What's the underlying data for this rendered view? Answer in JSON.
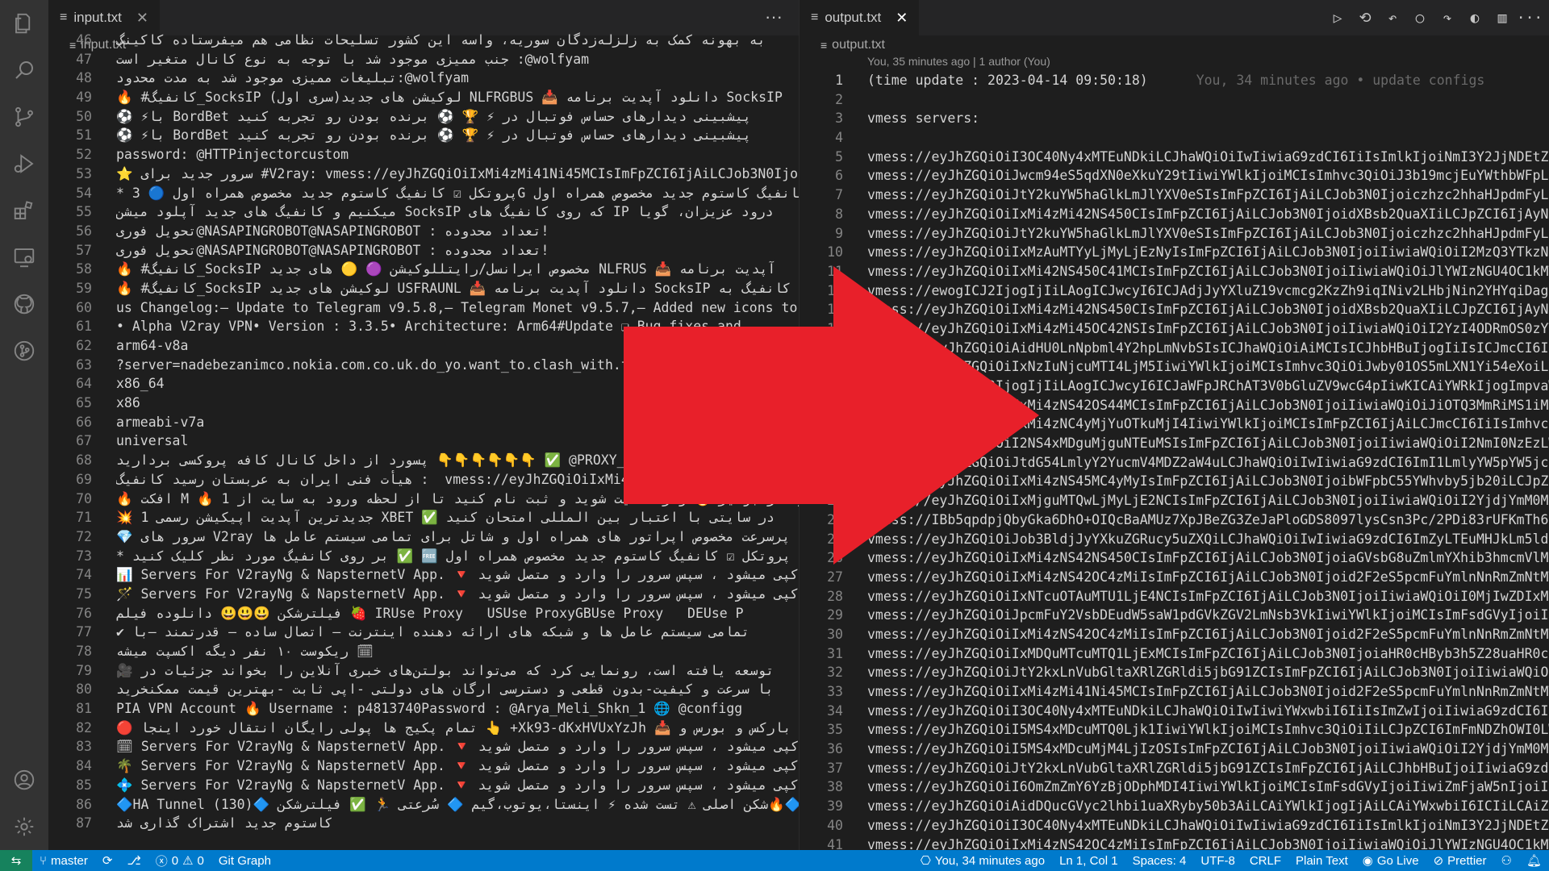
{
  "left_pane": {
    "tab": {
      "label": "input.txt",
      "close": "✕"
    },
    "more": "···",
    "breadcrumb": "input.txt",
    "lines": [
      {
        "n": "46",
        "text": "به بهونه کمک به زلزله‌زدگان سوریه، واسه این کشور تسلیحات نظامی هم میفرستاده کاکینگ"
      },
      {
        "n": "47",
        "text": "جنب ممیزی موجود شد با توجه به نوع کانال متغیر است :@wolfyam"
      },
      {
        "n": "48",
        "text": "تبلیغات ممیزی موجود شد به مدت محدود:@wolfyam"
      },
      {
        "n": "49",
        "text": "🔥 #کانفیگ_SocksIP لوکیشن های جدید(سری اول) NLFRGBUS 📥 دانلود آپدیت برنامه SocksIP"
      },
      {
        "n": "50",
        "text": "⚽ ⚡با BordBet پیشبینی دیدارهای حساس فوتبال در ⚡ 🏆 ⚽ برنده بودن رو تجربه کنید"
      },
      {
        "n": "51",
        "text": "⚽ ⚡با BordBet پیشبینی دیدارهای حساس فوتبال در ⚡ 🏆 ⚽ برنده بودن رو تجربه کنید"
      },
      {
        "n": "52",
        "text": "password: @HTTPinjectorcustom"
      },
      {
        "n": "53",
        "text": "⭐ سرور جدید برای #V2ray: vmess://eyJhZGQiOiIxMi4zMi41Ni45MCIsImFpZCI6IjAiLCJob3N0Ijoid"
      },
      {
        "n": "54",
        "text": "* پروتکل ☑ کانفیگ کاستوم جدید مخصوص همراه اول 🔵 3G کانفیگ کاستوم جدید مخصوص همراه اول"
      },
      {
        "n": "55",
        "text": "میکنیم و کانفیگ های جدید آپلود میشن SocksIP که روی کانفیگ های IP درود عزیزان، گویا"
      },
      {
        "n": "56",
        "text": "تحویل فوری@NASAPINGROBOT@NASAPINGROBOT : تعداد محدوده!"
      },
      {
        "n": "57",
        "text": "تحویل فوری@NASAPINGROBOT@NASAPINGROBOT : تعداد محدوده!"
      },
      {
        "n": "58",
        "text": "🔥 #کانفیگ_SocksIP مخصوص ایرانسل/رایتللوکیشن 🟣 🟡 های جدید NLFRUS 📥 آپدیت برنامه"
      },
      {
        "n": "59",
        "text": "🔥 #کانفیگ_SocksIP لوکیشن های جدید USFRAUNL 📥 دانلود آپدیت برنامه SocksIP کانفیگ به"
      },
      {
        "n": "60",
        "text": "us Changelog:– Update to Telegram v9.5.8,– Telegram Monet v9.5.7,– Added new icons to Ta"
      },
      {
        "n": "61",
        "text": "• Alpha V2ray VPN• Version : 3.3.5• Architecture: Arm64#Update ❏ Bug fixes and"
      },
      {
        "n": "62",
        "text": "arm64-v8a"
      },
      {
        "n": "63",
        "text": "?server=nadebezanimco.nokia.com.co.uk.do_yo.want_to.clash_with.this"
      },
      {
        "n": "64",
        "text": "x86_64"
      },
      {
        "n": "65",
        "text": "x86"
      },
      {
        "n": "66",
        "text": "armeabi-v7a"
      },
      {
        "n": "67",
        "text": "universal"
      },
      {
        "n": "68",
        "text": "پسورد از داخل کانال کافه پروکسی بردارید 👇👇👇👇👇👇 ✅ @PROXY_"
      },
      {
        "n": "69",
        "text": "هیأت فنی ایران به عربستان رسید کانفیگ :  vmess://eyJhZGQiOiIxMi4zNS42OC4zMiIsImFpZCI6I"
      },
      {
        "n": "70",
        "text": "🔥 افکت M 🔥 1 ویژه از جوایز 🔥 وارد سایت شوید و ثبت نام کنید تا از لحظه ورود به سایت از"
      },
      {
        "n": "71",
        "text": "💥 1 جدیدترین آپدیت اپیکیشن رسمی XBET ✅ در سایتی با اعتبار بین المللی امتحان کنید"
      },
      {
        "n": "72",
        "text": "💎 سرور های V2ray پرسرعت مخصوص اپراتور های همراه اول و شاتل برای تمامی سیستم عامل ها"
      },
      {
        "n": "73",
        "text": "* بر روی کانفیگ مورد نظر کلیک کنید ✅ 🆓 پروتکل ☑ کانفیگ کاستوم جدید مخصوص همراه اول"
      },
      {
        "n": "74",
        "text": "📊 Servers For V2rayNg & NapsternetV App. 🔻 کپی میشود ، سپس سرور را وارد و متصل شوید"
      },
      {
        "n": "75",
        "text": "🪄 Servers For V2rayNg & NapsternetV App. 🔻 کپی میشود ، سپس سرور را وارد و متصل شوید"
      },
      {
        "n": "76",
        "text": "فیلترشکن 😃😃😃 دانلوده فیلم 🍓 IRUse Proxy   USUse ProxyGBUse Proxy   DEUse P"
      },
      {
        "n": "77",
        "text": "✔ تمامی سیستم عامل ها و شبکه های ارائه دهنده اینترنت — اتصال ساده — قدرتمند —با"
      },
      {
        "n": "78",
        "text": "ریکوست ۱۰ نفر دیگه اکسپت میشه 🗓"
      },
      {
        "n": "79",
        "text": "🎥 توسعه یافته است، رونمایی کرد که می‌تواند بولتن‌های خبری آنلاین را بخواند جزئیات در"
      },
      {
        "n": "80",
        "text": "با سرعت و کیفیت-بدون قطعی و دسترسی ارگان های دولتی -اپی ثابت -بهترین قیمت ممکنخرید"
      },
      {
        "n": "81",
        "text": "PIA VPN Account 🔥 Username : p4813740Password : @Arya_Meli_Shkn_1 🌐 @configg"
      },
      {
        "n": "82",
        "text": "🔴 تمام پکیج ها پولی رایگان انتقال خورد اینجا 👆 +Xk93-dKxHVUxYzJh 📥 بارکس و بورس و ☑"
      },
      {
        "n": "83",
        "text": "🗓 Servers For V2rayNg & NapsternetV App. 🔻 کپی میشود ، سپس سرور را وارد و متصل شوید"
      },
      {
        "n": "84",
        "text": "🌴 Servers For V2rayNg & NapsternetV App. 🔻 کپی میشود ، سپس سرور را وارد و متصل شوید"
      },
      {
        "n": "85",
        "text": "💠 Servers For V2rayNg & NapsternetV App. 🔻 کپی میشود ، سپس سرور را وارد و متصل شوید"
      },
      {
        "n": "86",
        "text": "🔷HA Tunnel (130)🔷 برنامه 🔷🔥شکن اصلی ⚠ تست شده ⚡ اینستا،یوتوب،گیم 🔷 سُرعتی 🏃 ✅ فیلترشکن"
      },
      {
        "n": "87",
        "text": "کاستوم جدید اشتراک گذاری شد"
      }
    ]
  },
  "right_pane": {
    "tab": {
      "label": "output.txt",
      "close": "✕"
    },
    "breadcrumb": "output.txt",
    "blame": "You, 35 minutes ago | 1 author (You)",
    "ghost": "You, 34 minutes ago • update configs",
    "lines": [
      {
        "n": "1",
        "text": "(time update : 2023-04-14 09:50:18)"
      },
      {
        "n": "2",
        "text": ""
      },
      {
        "n": "3",
        "text": "vmess servers:"
      },
      {
        "n": "4",
        "text": ""
      },
      {
        "n": "5",
        "text": "vmess://eyJhZGQiOiI3OC40Ny4xMTEuNDkiLCJhaWQiOiIwIiwiaG9zdCI6IiIsImlkIjoiNmI3Y2JjNDEtZmI4"
      },
      {
        "n": "6",
        "text": "vmess://eyJhZGQiOiJwcm94eS5qdXN0eXkuY29tIiwiYWlkIjoiMCIsImhvc3QiOiJ3b19mcjEuYWthbWFpLmV1"
      },
      {
        "n": "7",
        "text": "vmess://eyJhZGQiOiJtY2kuYW5haGlkLmJlYXV0eSIsImFpZCI6IjAiLCJob3N0Ijoiczhzc2hhaHJpdmFyLnNo"
      },
      {
        "n": "8",
        "text": "vmess://eyJhZGQiOiIxMi4zMi42NS450CIsImFpZCI6IjAiLCJob3N0IjoidXBsb2QuaXIiLCJpZCI6IjAyNzBl"
      },
      {
        "n": "9",
        "text": "vmess://eyJhZGQiOiJtY2kuYW5haGlkLmJlYXV0eSIsImFpZCI6IjAiLCJob3N0Ijoiczhzc2hhaHJpdmFyLnNo"
      },
      {
        "n": "10",
        "text": "vmess://eyJhZGQiOiIxMzAuMTYyLjMyLjEzNyIsImFpZCI6IjAiLCJob3N0IjoiIiwiaWQiOiI2MzQ3YTkzNS02"
      },
      {
        "n": "11",
        "text": "vmess://eyJhZGQiOiIxMi42NS450C41MCIsImFpZCI6IjAiLCJob3N0IjoiIiwiaWQiOiJlYWIzNGU4OC1kMTYy"
      },
      {
        "n": "12",
        "text": "vmess://ewogICJ2IjogIjIiLAogICJwcyI6ICJAdjJyYXluZ19vcmcg2KzZh9iqINiv2LHbjNin2YHYqiDagdin"
      },
      {
        "n": "13",
        "text": "vmess://eyJhZGQiOiIxMi4zMi42NS450CIsImFpZCI6IjAiLCJob3N0IjoidXBsb2QuaXIiLCJpZCI6IjAyNzBl"
      },
      {
        "n": "14",
        "text": "vmess://eyJhZGQiOiIxMi4zMi45OC42NSIsImFpZCI6IjAiLCJob3N0IjoiIiwiaWQiOiI2YzI4ODRmOS0zYTM5"
      },
      {
        "n": "15",
        "text": "vmess://eyJhZGQiOiAidHU0LnNpbml4Y2hpLmNvbSIsICJhaWQiOiAiMCIsICJhbHBuIjogIiIsICJmcCI6ICIi"
      },
      {
        "n": "16",
        "text": "vmess://eyJhZGQiOiIxNzIuNjcuMTI4LjM5IiwiYWlkIjoiMCIsImhvc3QiOiJwby01OS5mLXN1Yi54eXoiLCJp"
      },
      {
        "n": "17",
        "text": "vmess://ewogICJ2IjogIjIiLAogICJwcyI6ICJaWFpJRChAT3V0bGluZV9wcG4pIiwKICAiYWRkIjogImpvaW4t"
      },
      {
        "n": "18",
        "text": "vmess://eyJhZGQiOiIxMi4zNS42OS44MCIsImFpZCI6IjAiLCJob3N0IjoiIiwiaWQiOiJiOTQ3MmRiMS1iM2Vj"
      },
      {
        "n": "19",
        "text": "vmess://eyJhZGQiOiIxMi4zNC4yMjYuOTkuMjI4IiwiYWlkIjoiMCIsImFpZCI6IjAiLCJmcCI6IiIsImhvc3QiOiIi"
      },
      {
        "n": "20",
        "text": "vmess://eyJhZGQiOiI2NS4xMDguMjguNTEuMSIsImFpZCI6IjAiLCJob3N0IjoiIiwiaWQiOiI2NmI0NzEzLWEy"
      },
      {
        "n": "21",
        "text": "vmess://eyJhZGQiOiJtdG54LmlyY2YucmV4MDZ2aW4uLCJhaWQiOiIwIiwiaG9zdCI6ImI1LmlyYW5pYW5jcC5hdXRv"
      },
      {
        "n": "22",
        "text": "vmess://eyJhZGQiOiIxMi4zNS45MC4yMyIsImFpZCI6IjAiLCJob3N0IjoibWFpbC55YWhvby5jb20iLCJpZCI6"
      },
      {
        "n": "23",
        "text": "vmess://eyJhZGQiOiIxMjguMTQwLjMyLjE2NCIsImFpZCI6IjAiLCJob3N0IjoiIiwiaWQiOiI2YjdjYmM0MS0z"
      },
      {
        "n": "24",
        "text": "vmess://IBb5qpdpjQbyGka6DhO+OIQcBaAMUz7XpJBeZG3ZeJaPloGDS8097lysCsn3Pc/2PDi83rUFKmTh6zv2"
      },
      {
        "n": "25",
        "text": "vmess://eyJhZGQiOiJob3BldjJyYXkuZGRucy5uZXQiLCJhaWQiOiIwIiwiaG9zdCI6ImZyLTEuMHJkLm5ldCIs"
      },
      {
        "n": "26",
        "text": "vmess://eyJhZGQiOiIxMi4zNS42NS450CIsImFpZCI6IjAiLCJob3N0IjoiaGVsbG8uZmlmYXhib3hmcmVlMDIx"
      },
      {
        "n": "27",
        "text": "vmess://eyJhZGQiOiIxMi4zNS42OC4zMiIsImFpZCI6IjAiLCJob3N0Ijoid2F2eS5pcmFuYmlnNnRmZmNtMTY1"
      },
      {
        "n": "28",
        "text": "vmess://eyJhZGQiOiIxNTcuOTAuMTU1LjE4NCIsImFpZCI6IjAiLCJob3N0IjoiIiwiaWQiOiI0MjIwZDIxMy1l"
      },
      {
        "n": "29",
        "text": "vmess://eyJhZGQiOiJpcmFuY2VsbDEudW5saW1pdGVkZGV2LmNsb3VkIiwiYWlkIjoiMCIsImFsdGVyIjoiIiwi"
      },
      {
        "n": "30",
        "text": "vmess://eyJhZGQiOiIxMi4zNS42OC4zMiIsImFpZCI6IjAiLCJob3N0Ijoid2F2eS5pcmFuYmlnNnRmZmNtMTY1"
      },
      {
        "n": "31",
        "text": "vmess://eyJhZGQiOiIxMDQuMTcuMTQ1LjExMCIsImFpZCI6IjAiLCJob3N0IjoiaHR0cHByb3h5Z28uaHR0cHBy"
      },
      {
        "n": "32",
        "text": "vmess://eyJhZGQiOiJtY2kxLnVubGltaXRlZGRldi5jbG91ZCIsImFpZCI6IjAiLCJob3N0IjoiIiwiaWQiOiI5"
      },
      {
        "n": "33",
        "text": "vmess://eyJhZGQiOiIxMi4zMi41Ni45MCIsImFpZCI6IjAiLCJob3N0Ijoid2F2eS5pcmFuYmlnNnRmZmNtMTY1"
      },
      {
        "n": "34",
        "text": "vmess://eyJhZGQiOiI3OC40Ny4xMTEuNDkiLCJhaWQiOiIwIiwiYWxwbiI6IiIsImZwIjoiIiwiaG9zdCI6IiIs"
      },
      {
        "n": "35",
        "text": "vmess://eyJhZGQiOiI5MS4xMDcuMTQ0Ljk1IiwiYWlkIjoiMCIsImhvc3QiOiIiLCJpZCI6ImFmNDZhOWI0LWFk"
      },
      {
        "n": "36",
        "text": "vmess://eyJhZGQiOiI5MS4xMDcuMjM4LjIzOSIsImFpZCI6IjAiLCJob3N0IjoiIiwiaWQiOiI2YjdjYmM0MS0z"
      },
      {
        "n": "37",
        "text": "vmess://eyJhZGQiOiJtY2kxLnVubGltaXRlZGRldi5jbG91ZCIsImFpZCI6IjAiLCJhbHBuIjoiIiwiaG9zdCI6"
      },
      {
        "n": "38",
        "text": "vmess://eyJhZGQiOiI6OmZmZmY6YzBjODphMDI4IiwiYWlkIjoiMCIsImFsdGVyIjoiIiwiZmFjaW5nIjoiIiwi"
      },
      {
        "n": "39",
        "text": "vmess://eyJhZGQiOiAidDQucGVyc2lhbi1uaXRyby50b3AiLCAiYWlkIjogIjAiLCAiYWxwbiI6ICIiLCAiZnAi"
      },
      {
        "n": "40",
        "text": "vmess://eyJhZGQiOiI3OC40Ny4xMTEuNDkiLCJhaWQiOiIwIiwiaG9zdCI6IiIsImlkIjoiNmI3Y2JjNDEtZmI4"
      },
      {
        "n": "41",
        "text": "vmess://eyJhZGQiOiIxMi4zNS42OC4zMiIsImFpZCI6IjAiLCJob3N0IjoiIiwiaWQiOiJlYWIzNGU4OC1kMTYy"
      }
    ]
  },
  "status_bar": {
    "branch": "master",
    "errors": "0",
    "warnings": "0",
    "git_graph": "Git Graph",
    "blame": "You, 34 minutes ago",
    "position": "Ln 1, Col 1",
    "spaces": "Spaces: 4",
    "encoding": "UTF-8",
    "eol": "CRLF",
    "language": "Plain Text",
    "go_live": "Go Live",
    "prettier": "Prettier"
  },
  "colors": {
    "status_bg": "#007acc",
    "remote_bg": "#16825d",
    "arrow": "#e8202a",
    "editor_bg": "#1e1e1e"
  }
}
